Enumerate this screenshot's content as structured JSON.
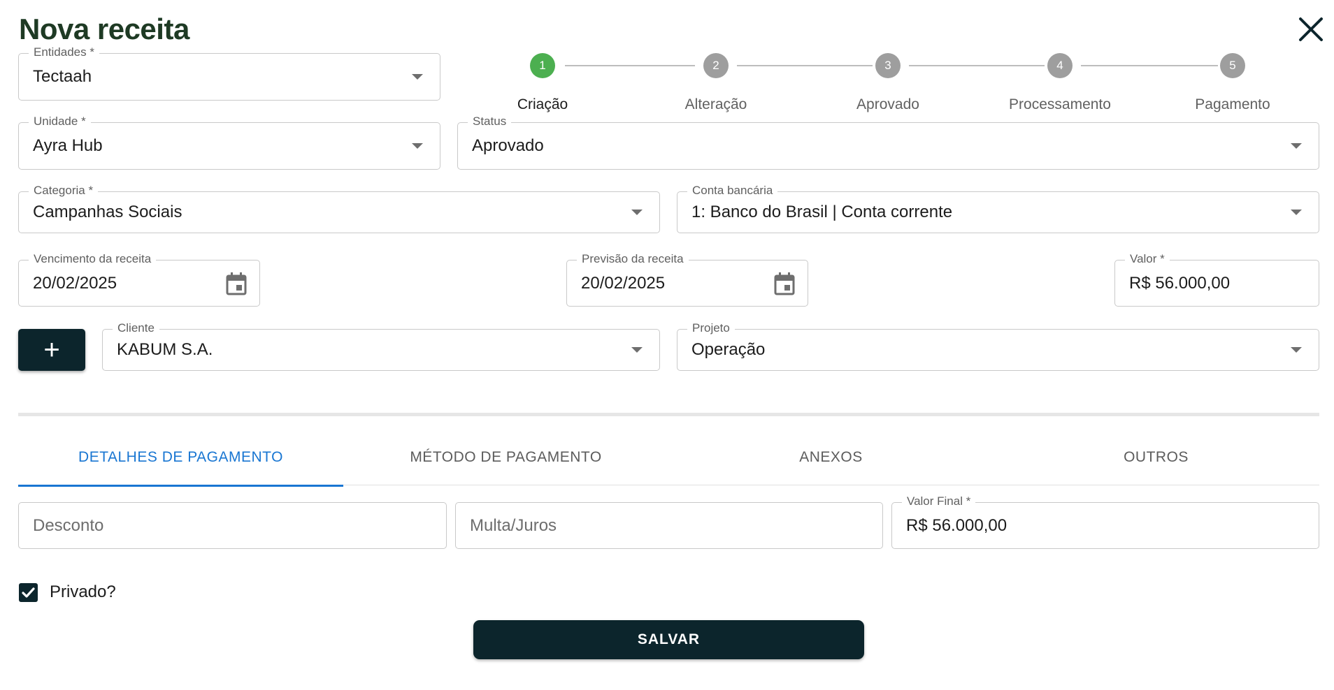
{
  "dialog": {
    "title": "Nova receita"
  },
  "icons": {
    "close": "close-icon",
    "calendar": "calendar-icon",
    "add": "plus-icon",
    "check": "check-icon",
    "dropdown": "chevron-down-icon"
  },
  "stepper": {
    "active_index": 0,
    "steps": [
      {
        "number": "1",
        "label": "Criação"
      },
      {
        "number": "2",
        "label": "Alteração"
      },
      {
        "number": "3",
        "label": "Aprovado"
      },
      {
        "number": "4",
        "label": "Processamento"
      },
      {
        "number": "5",
        "label": "Pagamento"
      }
    ]
  },
  "form": {
    "entidades": {
      "label": "Entidades",
      "required": "*",
      "value": "Tectaah"
    },
    "unidade": {
      "label": "Unidade",
      "required": "*",
      "value": "Ayra Hub"
    },
    "status": {
      "label": "Status",
      "value": "Aprovado"
    },
    "categoria": {
      "label": "Categoria",
      "required": "*",
      "value": "Campanhas Sociais"
    },
    "conta_bancaria": {
      "label": "Conta bancária",
      "value": "1: Banco do Brasil | Conta corrente"
    },
    "vencimento": {
      "label": "Vencimento da receita",
      "value": "20/02/2025"
    },
    "previsao": {
      "label": "Previsão da receita",
      "value": "20/02/2025"
    },
    "valor": {
      "label": "Valor",
      "required": "*",
      "value": "R$ 56.000,00"
    },
    "cliente": {
      "label": "Cliente",
      "value": "KABUM S.A."
    },
    "projeto": {
      "label": "Projeto",
      "value": "Operação"
    },
    "add_button_symbol": "+"
  },
  "tabs": {
    "active_index": 0,
    "items": [
      {
        "label": "DETALHES DE PAGAMENTO"
      },
      {
        "label": "MÉTODO DE PAGAMENTO"
      },
      {
        "label": "ANEXOS"
      },
      {
        "label": "OUTROS"
      }
    ]
  },
  "payment": {
    "desconto": {
      "placeholder": "Desconto"
    },
    "multa_juros": {
      "placeholder": "Multa/Juros"
    },
    "valor_final": {
      "label": "Valor Final",
      "required": "*",
      "value": "R$ 56.000,00"
    }
  },
  "privado": {
    "label": "Privado?",
    "checked": true
  },
  "actions": {
    "save_label": "SALVAR"
  },
  "colors": {
    "brand_dark": "#0c252c",
    "title_green": "#1e3a24",
    "step_active": "#4caf50",
    "step_inactive": "#9e9e9e",
    "tab_active": "#1976d2"
  }
}
